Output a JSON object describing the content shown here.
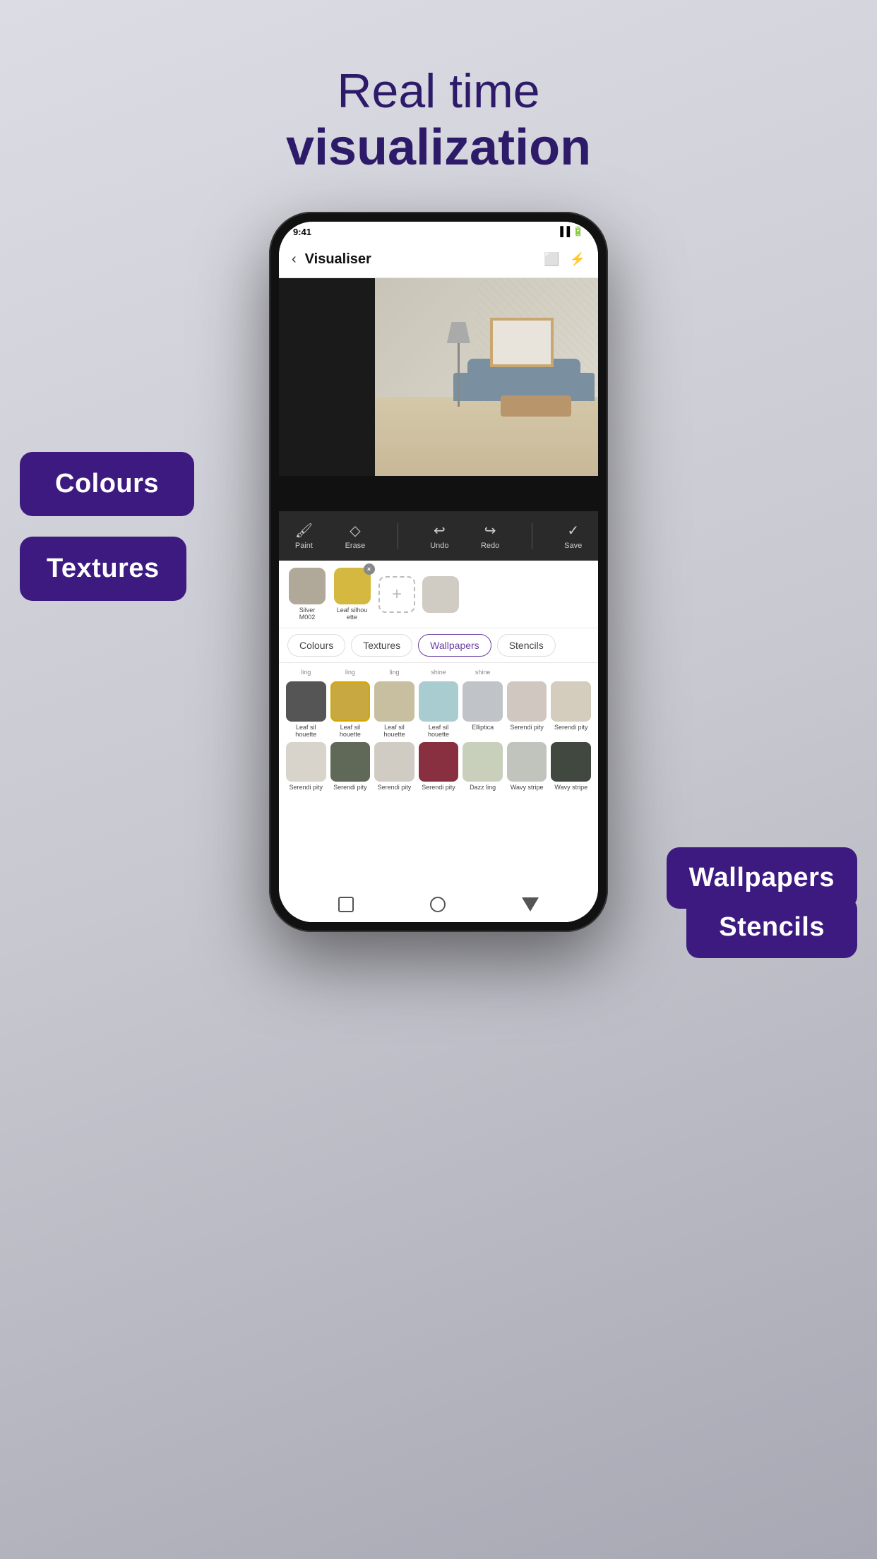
{
  "hero": {
    "line1": "Real time",
    "line2": "visualization"
  },
  "phone": {
    "header": {
      "back_label": "‹",
      "title": "Visualiser",
      "icon_chat": "💬",
      "icon_share": "⚡"
    },
    "toolbar": {
      "items": [
        {
          "icon": "🖌️",
          "label": "Paint"
        },
        {
          "icon": "◇",
          "label": "Erase"
        },
        {
          "icon": "↩",
          "label": "Undo"
        },
        {
          "icon": "↪",
          "label": "Redo"
        },
        {
          "icon": "✓",
          "label": "Save"
        }
      ]
    },
    "selected": [
      {
        "label": "Silver\nM002",
        "color": "#b0a898"
      },
      {
        "label": "Leaf silhouette",
        "color": "#d4b840"
      }
    ],
    "tabs": [
      {
        "label": "Colours",
        "active": false
      },
      {
        "label": "Textures",
        "active": false
      },
      {
        "label": "Wallpapers",
        "active": true
      },
      {
        "label": "Stencils",
        "active": false
      }
    ],
    "grid": {
      "rows": [
        {
          "items": [
            {
              "color": "#888",
              "top_label": "ling",
              "label": "Leaf silhouette"
            },
            {
              "color": "#c8a840",
              "top_label": "ling",
              "label": "Leaf silhouette"
            },
            {
              "color": "#c8bea0",
              "top_label": "ling",
              "label": "Leaf silhouette"
            },
            {
              "color": "#a8ccd0",
              "top_label": "shine",
              "label": "Leaf silhouette"
            },
            {
              "color": "#c0c4c8",
              "top_label": "shine",
              "label": "Elliptica"
            },
            {
              "color": "#d0c8c0",
              "top_label": "",
              "label": "Serendipity"
            },
            {
              "color": "#d4ccbc",
              "top_label": "",
              "label": "Serendipity"
            }
          ]
        },
        {
          "items": [
            {
              "color": "#d8d4cc",
              "top_label": "",
              "label": "Serendipity"
            },
            {
              "color": "#606858",
              "top_label": "",
              "label": "Serendipity"
            },
            {
              "color": "#d0ccc4",
              "top_label": "",
              "label": "Serendipity"
            },
            {
              "color": "#883040",
              "top_label": "",
              "label": "Serendipity"
            },
            {
              "color": "#c8d0bc",
              "top_label": "",
              "label": "Dazzling"
            },
            {
              "color": "#c0c4bc",
              "top_label": "",
              "label": "Wavy stripe"
            },
            {
              "color": "#404840",
              "top_label": "",
              "label": "Wavy stripe"
            }
          ]
        }
      ]
    }
  },
  "bubbles": {
    "colours": "Colours",
    "textures": "Textures",
    "wallpapers": "Wallpapers",
    "stencils": "Stencils"
  }
}
